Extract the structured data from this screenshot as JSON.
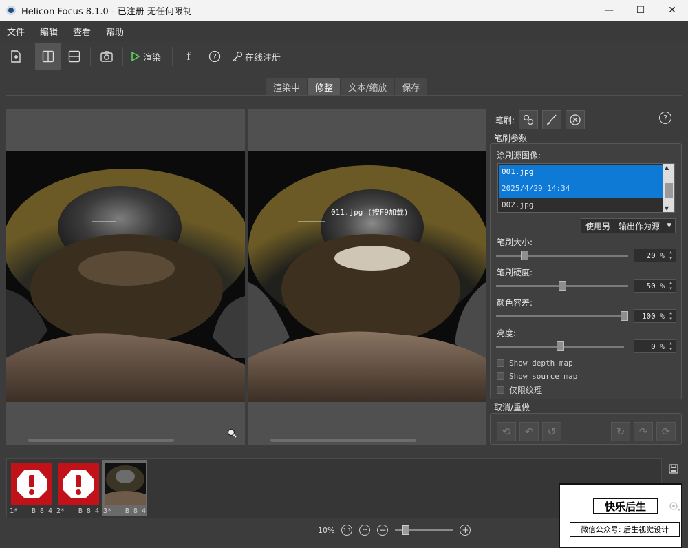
{
  "window": {
    "title": "Helicon Focus 8.1.0 - 已注册  无任何限制",
    "minimize": "—",
    "maximize": "☐",
    "close": "✕"
  },
  "menu": [
    "文件",
    "编辑",
    "查看",
    "帮助"
  ],
  "toolbar": {
    "render_label": "渲染",
    "register_label": "在线注册"
  },
  "tabs": [
    {
      "label": "渲染中",
      "active": false
    },
    {
      "label": "修整",
      "active": true
    },
    {
      "label": "文本/缩放",
      "active": false
    },
    {
      "label": "保存",
      "active": false
    }
  ],
  "viewer": {
    "overlay_label": "011.jpg (按F9加载)"
  },
  "brush": {
    "label": "笔刷:",
    "help": "?",
    "params_title": "笔刷参数",
    "source_title": "涂刷源图像:",
    "source_list": [
      {
        "name": "001.jpg",
        "date": "2025/4/29 14:34",
        "selected": true
      },
      {
        "name": "002.jpg",
        "date": "",
        "selected": false
      }
    ],
    "source_dropdown": "使用另一输出作为源",
    "size": {
      "label": "笔刷大小:",
      "value": "20 %",
      "level": 0.2
    },
    "hardness": {
      "label": "笔刷硬度:",
      "value": "50 %",
      "level": 0.5
    },
    "tolerance": {
      "label": "颜色容差:",
      "value": "100 %",
      "level": 1.0
    },
    "brightness": {
      "label": "亮度:",
      "value": "0 %",
      "level": 0.5
    },
    "show_depth_map": "Show depth map",
    "show_source_map": "Show source map",
    "texture_only": "仅限纹理"
  },
  "undo": {
    "title": "取消/重做"
  },
  "thumbnails": [
    {
      "index": "1*",
      "info": "B 8 4",
      "type": "error"
    },
    {
      "index": "2*",
      "info": "B 8 4",
      "type": "error"
    },
    {
      "index": "3*",
      "info": "B 8 4",
      "type": "image"
    }
  ],
  "zoom": {
    "level_text": "10%",
    "fit_label": "1:1"
  },
  "watermark": {
    "title": "快乐后生",
    "subtitle": "微信公众号: 后生视觉设计"
  }
}
